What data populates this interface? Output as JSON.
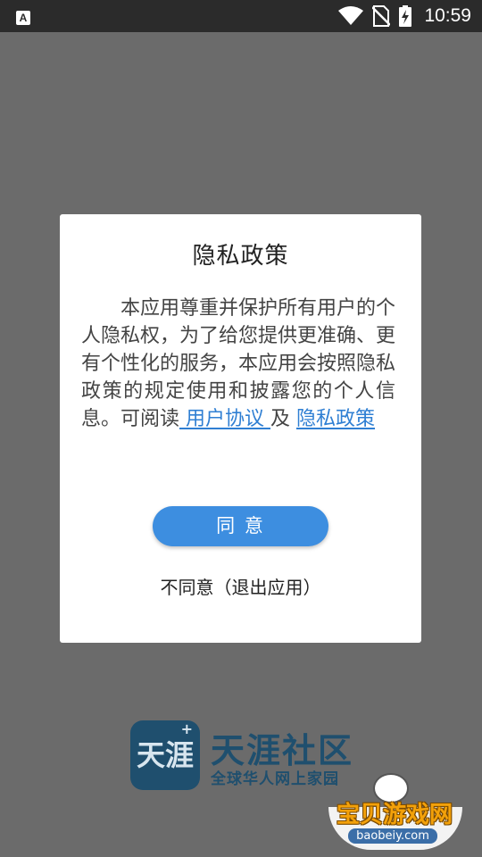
{
  "status_bar": {
    "app_icon_letter": "A",
    "time": "10:59",
    "icons": [
      "wifi-icon",
      "no-sim-icon",
      "battery-charging-icon"
    ]
  },
  "dialog": {
    "title": "隐私政策",
    "body_text": "本应用尊重并保护所有用户的个人隐私权，为了给您提供更准确、更有个性化的服务，本应用会按照隐私政策的规定使用和披露您的个人信息。可阅读",
    "user_agreement_link": " 用户协议 ",
    "conjunction": " 及 ",
    "privacy_policy_link": " 隐私政策 ",
    "agree_button": "同 意",
    "decline_button": "不同意（退出应用）"
  },
  "brand": {
    "logo_text": "天涯",
    "logo_badge": "+",
    "name": "天涯社区",
    "slogan": "全球华人网上家园"
  },
  "watermark": {
    "title": "宝贝游戏网",
    "url": "baobeiy.com"
  },
  "colors": {
    "overlay": "#6b6b6b",
    "status_bar": "#2b2b2b",
    "link": "#2f7fd3",
    "button": "#3d8ee0",
    "brand": "#1f4f6e"
  }
}
